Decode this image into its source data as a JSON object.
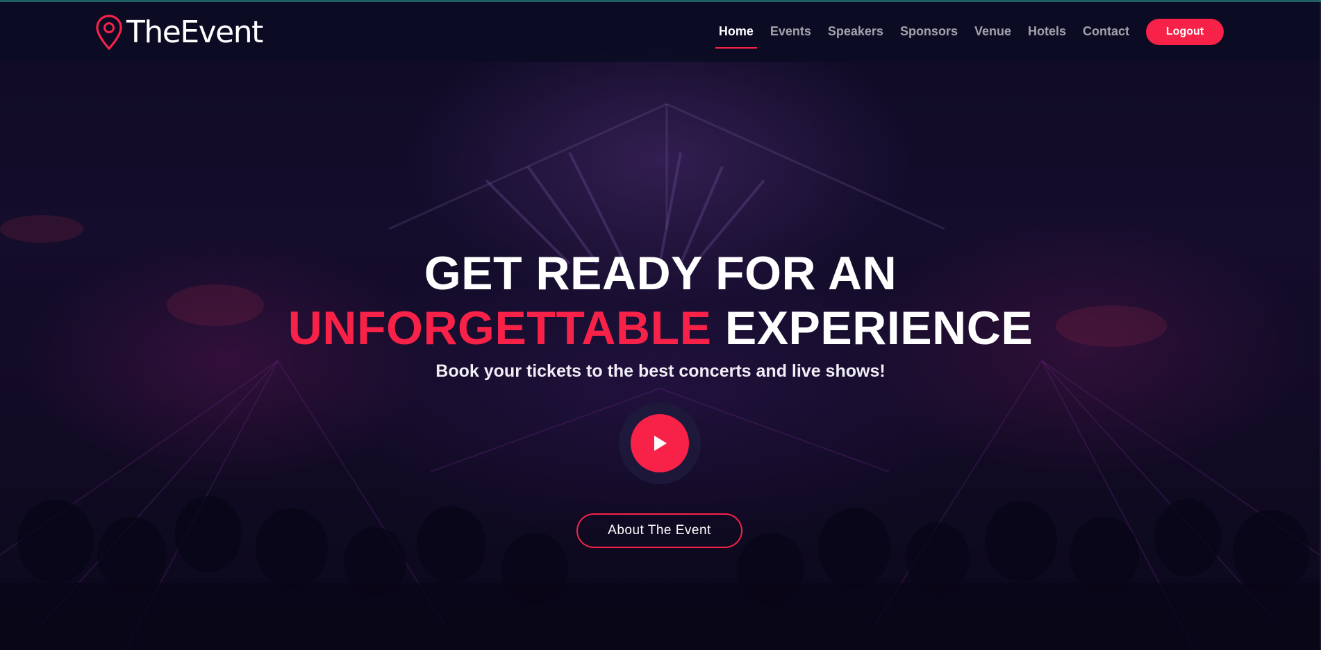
{
  "brand": {
    "name": "TheEvent",
    "logo_icon": "map-pin-icon",
    "accent_color": "#f82249"
  },
  "nav": {
    "items": [
      {
        "label": "Home",
        "active": true
      },
      {
        "label": "Events",
        "active": false
      },
      {
        "label": "Speakers",
        "active": false
      },
      {
        "label": "Sponsors",
        "active": false
      },
      {
        "label": "Venue",
        "active": false
      },
      {
        "label": "Hotels",
        "active": false
      },
      {
        "label": "Contact",
        "active": false
      }
    ],
    "logout_label": "Logout"
  },
  "hero": {
    "title_line1": "GET READY FOR AN",
    "title_accent": "UNFORGETTABLE",
    "title_rest": "EXPERIENCE",
    "subtitle": "Book your tickets to the best concerts and live shows!",
    "play_icon": "play-icon",
    "about_label": "About The Event"
  }
}
